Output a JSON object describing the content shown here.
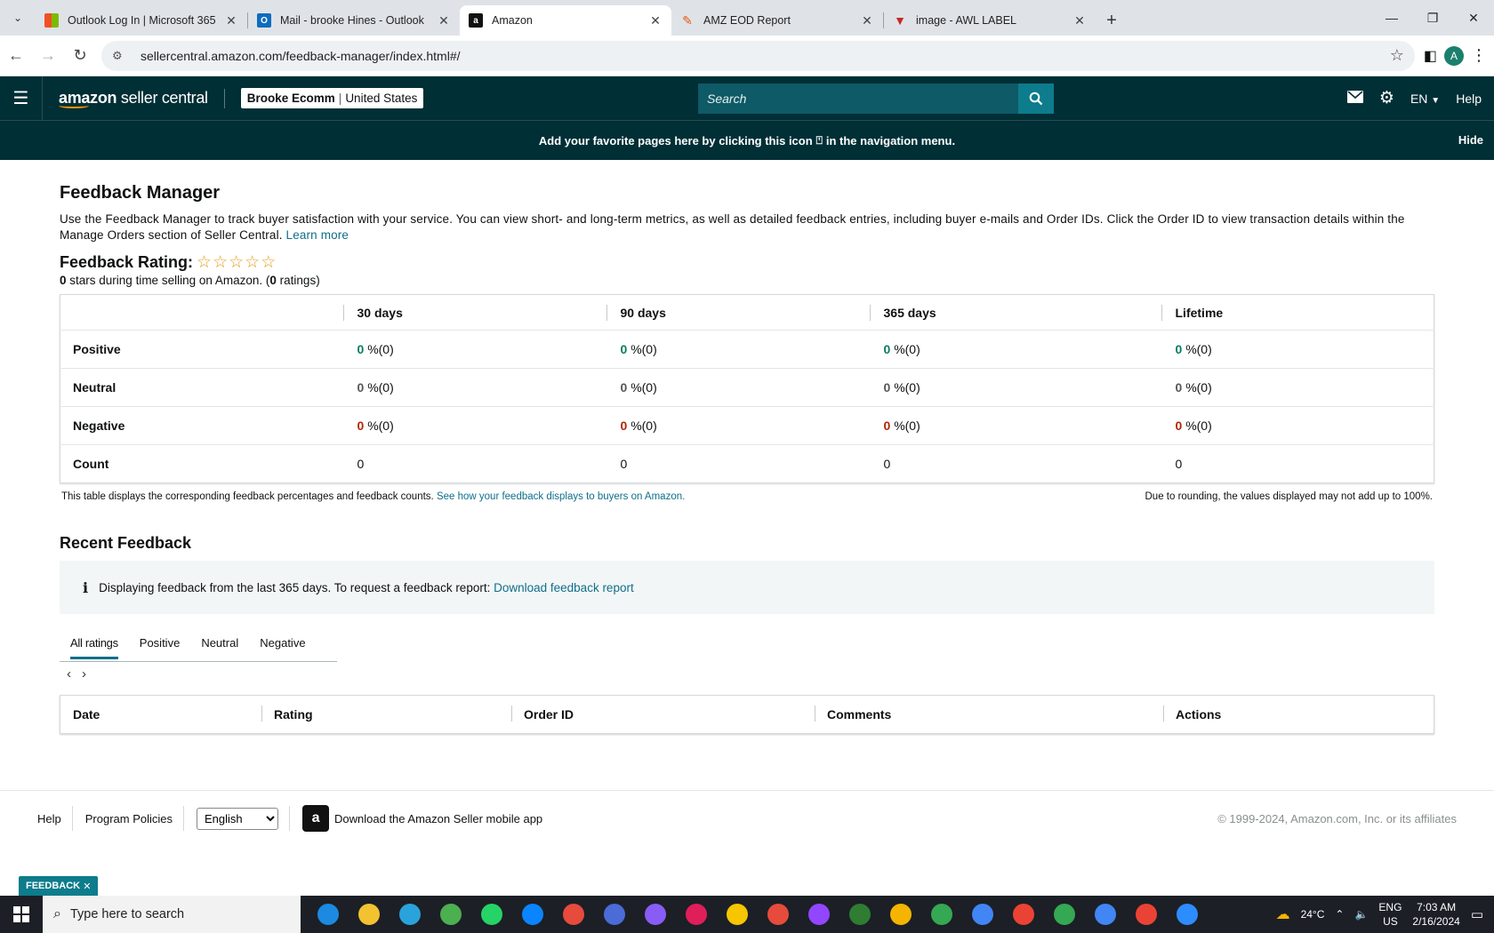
{
  "browser": {
    "tabs": [
      {
        "title": "Outlook Log In | Microsoft 365",
        "favicon": "microsoft-icon"
      },
      {
        "title": "Mail - brooke Hines - Outlook",
        "favicon": "outlook-icon"
      },
      {
        "title": "Amazon",
        "favicon": "amazon-icon",
        "active": true
      },
      {
        "title": "AMZ EOD Report",
        "favicon": "pen-icon"
      },
      {
        "title": "image - AWL LABEL",
        "favicon": "awl-icon"
      }
    ],
    "url": "sellercentral.amazon.com/feedback-manager/index.html#/",
    "profile_initial": "A"
  },
  "header": {
    "logo_bold": "amazon",
    "logo_rest": " seller central",
    "account_name": "Brooke Ecomm",
    "account_country": "United States",
    "search_placeholder": "Search",
    "language": "EN",
    "help": "Help"
  },
  "favbar": {
    "message_pre": "Add your favorite pages here by clicking this icon",
    "message_post": "in the navigation menu.",
    "hide": "Hide"
  },
  "page": {
    "title": "Feedback Manager",
    "description": "Use the Feedback Manager to track buyer satisfaction with your service. You can view short- and long-term metrics, as well as detailed feedback entries, including buyer e-mails and Order IDs. Click the Order ID to view transaction details within the Manage Orders section of Seller Central.",
    "learn_more": "Learn more",
    "rating_label": "Feedback Rating:",
    "stars_count": "0",
    "stars_text": "stars during time selling on Amazon. (",
    "ratings_count": "0",
    "ratings_text": "ratings)",
    "star_value": 0
  },
  "feedback_table": {
    "headers": [
      "30 days",
      "90 days",
      "365 days",
      "Lifetime"
    ],
    "rows": [
      {
        "label": "Positive",
        "cells": [
          [
            "0",
            "%(0)"
          ],
          [
            "0",
            "%(0)"
          ],
          [
            "0",
            "%(0)"
          ],
          [
            "0",
            "%(0)"
          ]
        ]
      },
      {
        "label": "Neutral",
        "cells": [
          [
            "0",
            "%(0)"
          ],
          [
            "0",
            "%(0)"
          ],
          [
            "0",
            "%(0)"
          ],
          [
            "0",
            "%(0)"
          ]
        ]
      },
      {
        "label": "Negative",
        "cells": [
          [
            "0",
            "%(0)"
          ],
          [
            "0",
            "%(0)"
          ],
          [
            "0",
            "%(0)"
          ],
          [
            "0",
            "%(0)"
          ]
        ]
      },
      {
        "label": "Count",
        "cells": [
          [
            "0"
          ],
          [
            "0"
          ],
          [
            "0"
          ],
          [
            "0"
          ]
        ]
      }
    ],
    "note_left": "This table displays the corresponding feedback percentages and feedback counts.",
    "note_link": "See how your feedback displays to buyers on Amazon.",
    "note_right": "Due to rounding, the values displayed may not add up to 100%."
  },
  "recent": {
    "title": "Recent Feedback",
    "info_text": "Displaying feedback from the last 365 days. To request a feedback report:",
    "info_link": "Download feedback report",
    "tabs": [
      "All ratings",
      "Positive",
      "Neutral",
      "Negative"
    ],
    "columns": [
      "Date",
      "Rating",
      "Order ID",
      "Comments",
      "Actions"
    ]
  },
  "footer": {
    "help": "Help",
    "policies": "Program Policies",
    "language_selected": "English",
    "app_text": "Download the Amazon Seller mobile app",
    "copyright": "© 1999-2024, Amazon.com, Inc. or its affiliates",
    "feedback_tag": "FEEDBACK"
  },
  "taskbar": {
    "search_placeholder": "Type here to search",
    "weather": "24°C",
    "lang_top": "ENG",
    "lang_bottom": "US",
    "time": "7:03 AM",
    "date": "2/16/2024",
    "app_colors": [
      "#1b8ae0",
      "#f2c230",
      "#2aa3dc",
      "#4caf50",
      "#25d366",
      "#0a84ff",
      "#e64b3c",
      "#4b6bd6",
      "#8a5cf6",
      "#e01e5a",
      "#f7c600",
      "#e64b3c",
      "#9146ff",
      "#2e7d32",
      "#f4b400",
      "#34a853",
      "#4285f4",
      "#ea4335",
      "#34a853",
      "#4285f4",
      "#ea4335",
      "#2d8cff"
    ]
  }
}
